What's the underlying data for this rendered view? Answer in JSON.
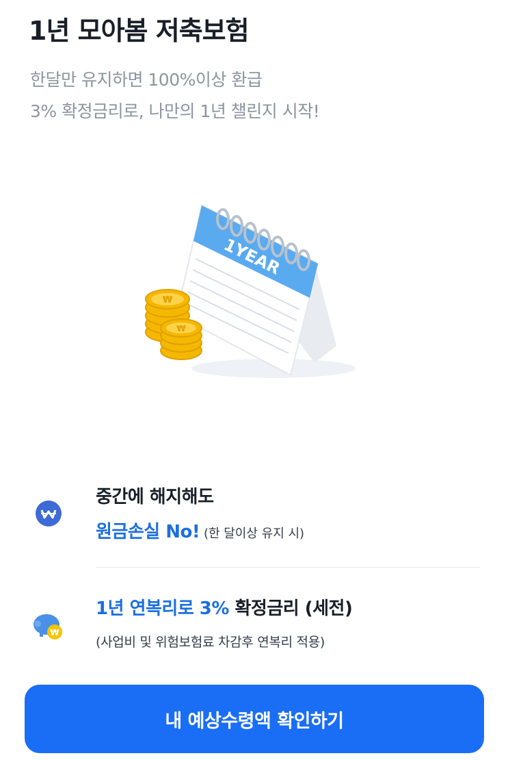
{
  "header": {
    "title": "1년 모아봄 저축보험",
    "subtitle_line1": "한달만 유지하면 100%이상 환급",
    "subtitle_line2": "3% 확정금리로, 나만의 1년 챌린지 시작!"
  },
  "hero": {
    "calendar_label": "1YEAR",
    "coin_symbol": "₩"
  },
  "features": [
    {
      "icon": "won-coin-icon",
      "title": "중간에 해지해도",
      "highlight": "원금손실 No!",
      "note": " (한 달이상 유지 시)"
    },
    {
      "icon": "piggy-bank-icon",
      "highlight": "1년 연복리로 3%",
      "title_rest": " 확정금리 (세전)",
      "note": "(사업비 및 위험보험료 차감후 연복리 적용)"
    }
  ],
  "cta": {
    "label": "내 예상수령액 확인하기"
  },
  "colors": {
    "accent": "#1a6ef5",
    "highlight_text": "#1b6fe0",
    "calendar_blue": "#5aaaf0",
    "coin_gold": "#f5b800"
  }
}
